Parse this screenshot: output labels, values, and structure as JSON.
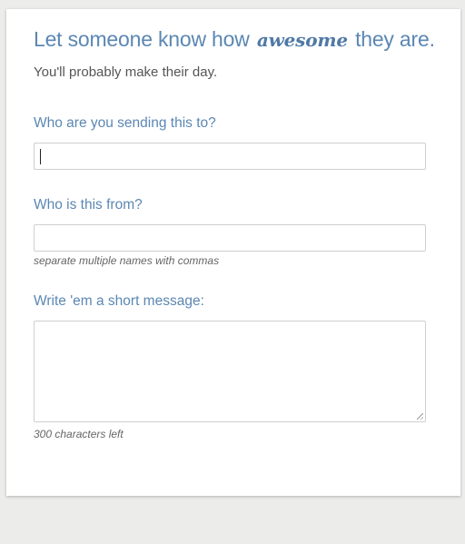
{
  "header": {
    "headline_before": "Let someone know how",
    "headline_emphasis": "awesome",
    "headline_after": "they are.",
    "subheadline": "You'll probably make their day."
  },
  "form": {
    "recipient": {
      "label": "Who are you sending this to?",
      "value": ""
    },
    "sender": {
      "label": "Who is this from?",
      "value": "",
      "hint": "separate multiple names with commas"
    },
    "message": {
      "label": "Write 'em a short message:",
      "value": "",
      "counter": "300 characters left"
    }
  },
  "colors": {
    "accent": "#5b87b3",
    "background": "#ececea",
    "card": "#ffffff"
  }
}
